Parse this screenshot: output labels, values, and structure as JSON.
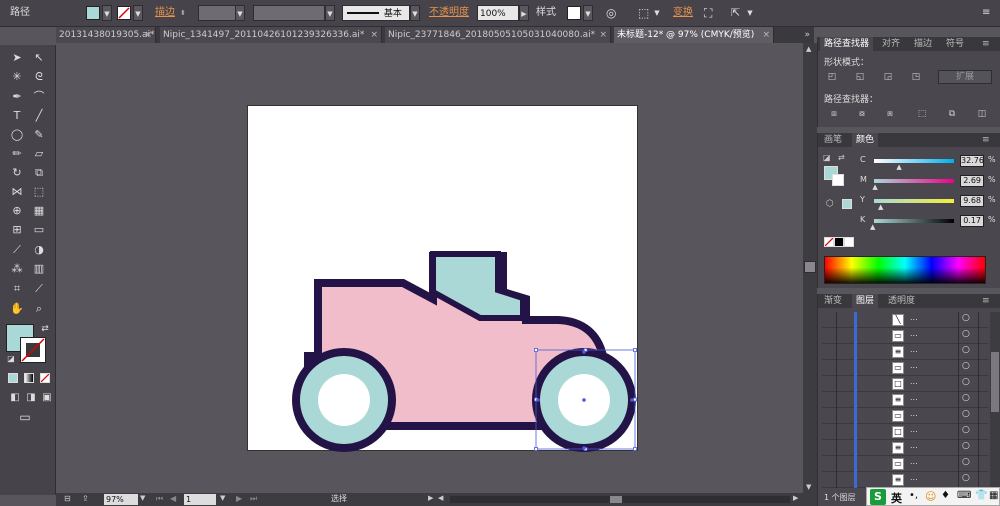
{
  "control_bar": {
    "object_type": "路径",
    "stroke_label": "描边",
    "opacity_label": "不透明度",
    "opacity_value": "100%",
    "stroke_style": "基本",
    "style_label": "样式",
    "transform_label": "变换",
    "fill_color": "#a9d8d6"
  },
  "documents": {
    "tabs": [
      {
        "label": "20131438019305.ai*"
      },
      {
        "label": "Nipic_1341497_20110426101239326336.ai*"
      },
      {
        "label": "Nipic_23771846_20180505105031040080.ai*"
      },
      {
        "label": "未标题-12* @ 97% (CMYK/预览)"
      }
    ]
  },
  "status": {
    "zoom": "97%",
    "page": "1",
    "tool_label": "选择"
  },
  "pathfinder": {
    "tabs": [
      "路径查找器",
      "对齐",
      "描边",
      "符号"
    ],
    "shape_modes_label": "形状模式：",
    "expand_label": "扩展",
    "pathfinders_label": "路径查找器："
  },
  "color_panel": {
    "tabs": [
      "画笔",
      "颜色"
    ],
    "channels": [
      {
        "name": "C",
        "value": "32.76",
        "fraction": 0.33
      },
      {
        "name": "M",
        "value": "2.69",
        "fraction": 0.03
      },
      {
        "name": "Y",
        "value": "9.68",
        "fraction": 0.1
      },
      {
        "name": "K",
        "value": "0.17",
        "fraction": 0.0
      }
    ],
    "percent_sign": "%"
  },
  "layers_panel": {
    "tabs": [
      "渐变",
      "图层",
      "透明度"
    ],
    "row_dots": "...",
    "row_count": 11,
    "footer": "1 个图层"
  },
  "ime": {
    "label": "英"
  },
  "colors": {
    "car_outline": "#241346",
    "car_body": "#f1bdca",
    "car_cab": "#a9d8d6",
    "wheel_tire": "#a9d8d6",
    "wheel_hub": "#ffffff",
    "selection": "#4a5cd8",
    "accent_orange": "#e7914a"
  }
}
